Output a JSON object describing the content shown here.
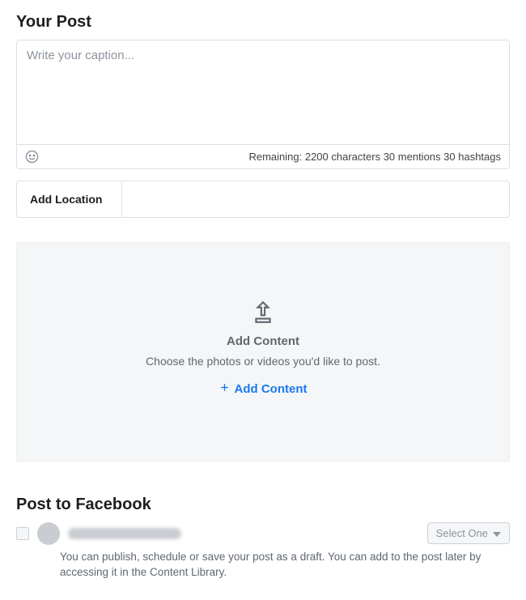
{
  "sections": {
    "your_post_title": "Your Post",
    "post_to_fb_title": "Post to Facebook"
  },
  "caption": {
    "placeholder": "Write your caption...",
    "remaining_label": "Remaining:",
    "remaining_chars": "2200 characters",
    "remaining_mentions": "30 mentions",
    "remaining_hashtags": "30 hashtags"
  },
  "location": {
    "add_location_label": "Add Location"
  },
  "content": {
    "title": "Add Content",
    "subtitle": "Choose the photos or videos you'd like to post.",
    "add_link_label": "Add Content"
  },
  "facebook": {
    "select_one_label": "Select One",
    "description": "You can publish, schedule or save your post as a draft. You can add to the post later by accessing it in the Content Library."
  }
}
